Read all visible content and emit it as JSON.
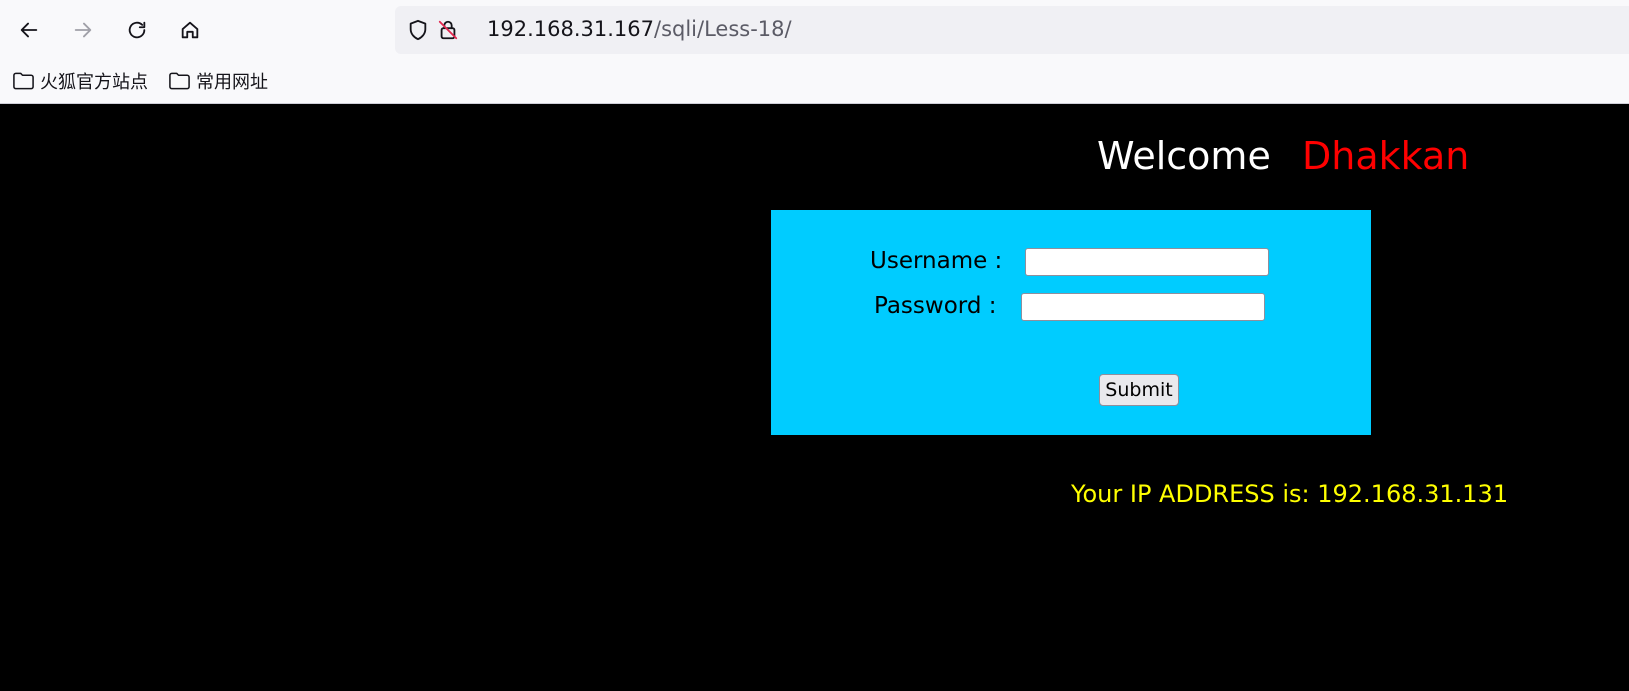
{
  "browser": {
    "url_host": "192.168.31.167",
    "url_path": "/sqli/Less-18/",
    "bookmarks": [
      {
        "label": "火狐官方站点"
      },
      {
        "label": "常用网址"
      }
    ]
  },
  "page": {
    "welcome": "Welcome",
    "welcome_name": "Dhakkan",
    "form": {
      "username_label": "Username :",
      "username_value": "",
      "password_label": "Password :",
      "password_value": "",
      "submit_label": "Submit"
    },
    "ip_text": "Your IP ADDRESS is: 192.168.31.131"
  },
  "colors": {
    "page_bg": "#000000",
    "form_bg": "#00ccff",
    "welcome": "#ffffff",
    "welcome_name": "#ff0000",
    "ip_text": "#ffff00"
  }
}
